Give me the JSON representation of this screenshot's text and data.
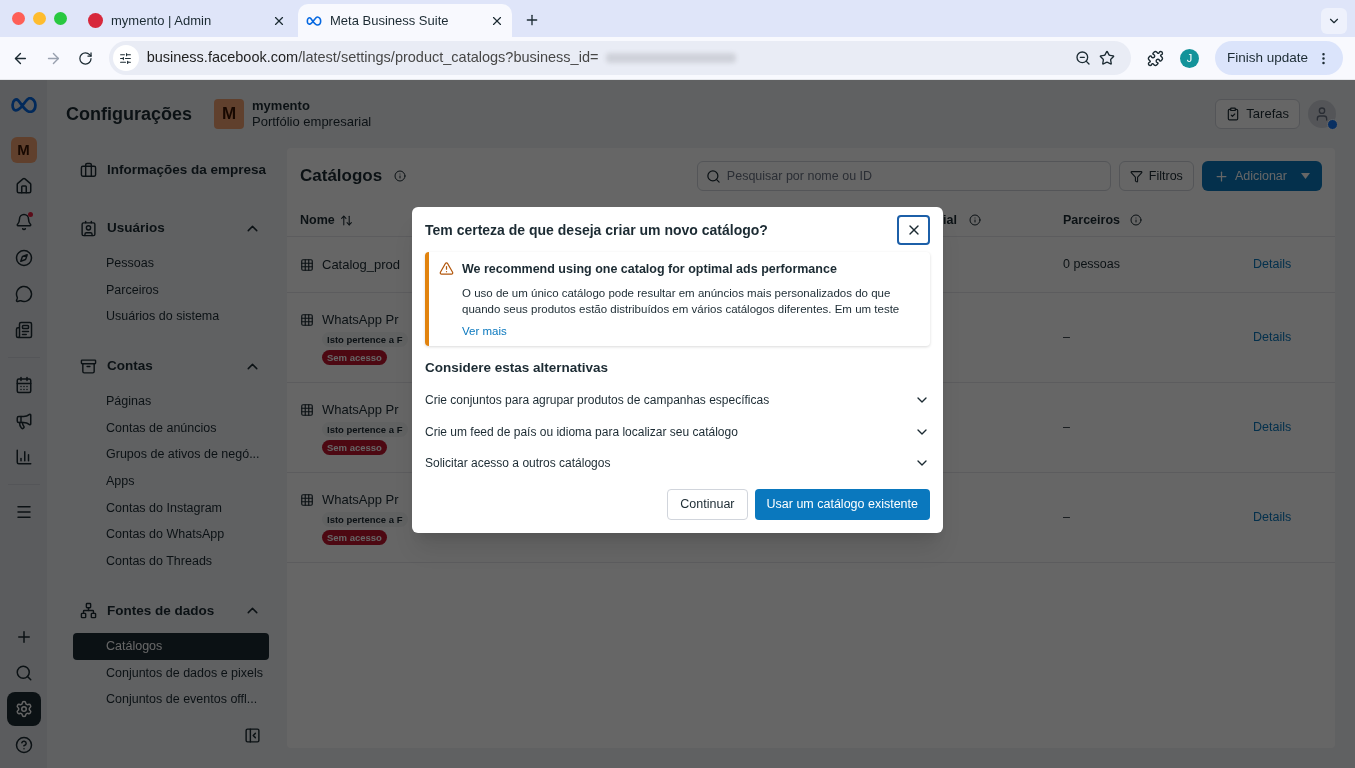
{
  "browser": {
    "tabs": [
      {
        "title": "mymento | Admin",
        "selected": false
      },
      {
        "title": "Meta Business Suite",
        "selected": true
      }
    ],
    "url_host": "business.facebook.com",
    "url_path": "/latest/settings/product_catalogs?business_id=",
    "profile_initial": "J",
    "update_button": "Finish update"
  },
  "header": {
    "title": "Configurações",
    "business": {
      "initial": "M",
      "name": "mymento",
      "subtitle": "Portfólio empresarial"
    },
    "tasks_button": "Tarefas"
  },
  "rail": {
    "avatar_initial": "M",
    "items": [
      {
        "kind": "home",
        "selected": false
      },
      {
        "kind": "bell",
        "selected": false
      },
      {
        "kind": "compass",
        "selected": false
      },
      {
        "kind": "chat",
        "selected": false
      },
      {
        "kind": "pages",
        "selected": false
      },
      {
        "kind": "calendar",
        "selected": false
      },
      {
        "kind": "megaphone",
        "selected": false
      },
      {
        "kind": "chart",
        "selected": false
      },
      {
        "kind": "menu",
        "selected": false
      }
    ],
    "bottom_items": [
      {
        "kind": "plus",
        "selected": false
      },
      {
        "kind": "search",
        "selected": false
      },
      {
        "kind": "settings",
        "selected": true
      },
      {
        "kind": "help",
        "selected": false
      }
    ]
  },
  "sidebar": {
    "sections": [
      {
        "title": "Informações da empresa"
      },
      {
        "title": "Usuários",
        "expanded": true,
        "items": [
          {
            "label": "Pessoas",
            "selected": false
          },
          {
            "label": "Parceiros",
            "selected": false
          },
          {
            "label": "Usuários do sistema",
            "selected": false
          }
        ]
      },
      {
        "title": "Contas",
        "expanded": true,
        "items": [
          {
            "label": "Páginas",
            "selected": false
          },
          {
            "label": "Contas de anúncios",
            "selected": false
          },
          {
            "label": "Grupos de ativos de negó...",
            "selected": false
          },
          {
            "label": "Apps",
            "selected": false
          },
          {
            "label": "Contas do Instagram",
            "selected": false
          },
          {
            "label": "Contas do WhatsApp",
            "selected": false
          },
          {
            "label": "Contas do Threads",
            "selected": false
          }
        ]
      },
      {
        "title": "Fontes de dados",
        "expanded": true,
        "items": [
          {
            "label": "Catálogos",
            "selected": true
          },
          {
            "label": "Conjuntos de dados e pixels",
            "selected": false
          },
          {
            "label": "Conjuntos de eventos offl...",
            "selected": false
          }
        ]
      }
    ]
  },
  "content": {
    "title": "Catálogos",
    "search_placeholder": "Pesquisar por nome ou ID",
    "filters_button": "Filtros",
    "add_button": "Adicionar",
    "columns": [
      "Nome",
      "ial",
      "Parceiros"
    ],
    "rows": [
      {
        "name": "Catalog_prod",
        "partners": "0 pessoas",
        "action": "Details"
      },
      {
        "name": "WhatsApp Pr",
        "tags": [
          {
            "kind": "owner",
            "text": "Isto pertence a F"
          },
          {
            "kind": "no_access",
            "text": "Sem acesso"
          }
        ],
        "partners": "–",
        "action": "Details"
      },
      {
        "name": "WhatsApp Pr",
        "tags": [
          {
            "kind": "owner",
            "text": "Isto pertence a F"
          },
          {
            "kind": "no_access",
            "text": "Sem acesso"
          }
        ],
        "partners": "–",
        "action": "Details"
      },
      {
        "name": "WhatsApp Pr",
        "tags": [
          {
            "kind": "owner",
            "text": "Isto pertence a F"
          },
          {
            "kind": "no_access",
            "text": "Sem acesso"
          }
        ],
        "partners": "–",
        "action": "Details"
      }
    ]
  },
  "dialog": {
    "title": "Tem certeza de que deseja criar um novo catálogo?",
    "alert": {
      "title": "We recommend using one catalog for optimal ads performance",
      "body": "O uso de um único catálogo pode resultar em anúncios mais personalizados do que quando seus produtos estão distribuídos em vários catálogos diferentes. Em um teste",
      "link": "Ver mais"
    },
    "alternatives_title": "Considere estas alternativas",
    "alternatives": [
      {
        "label": "Crie conjuntos para agrupar produtos de campanhas específicas",
        "expanded": false
      },
      {
        "label": "Crie um feed de país ou idioma para localizar seu catálogo",
        "expanded": false
      },
      {
        "label": "Solicitar acesso a outros catálogos",
        "expanded": false
      }
    ],
    "buttons": [
      {
        "kind": "secondary",
        "label": "Continuar"
      },
      {
        "kind": "primary",
        "label": "Usar um catálogo existente"
      }
    ]
  }
}
